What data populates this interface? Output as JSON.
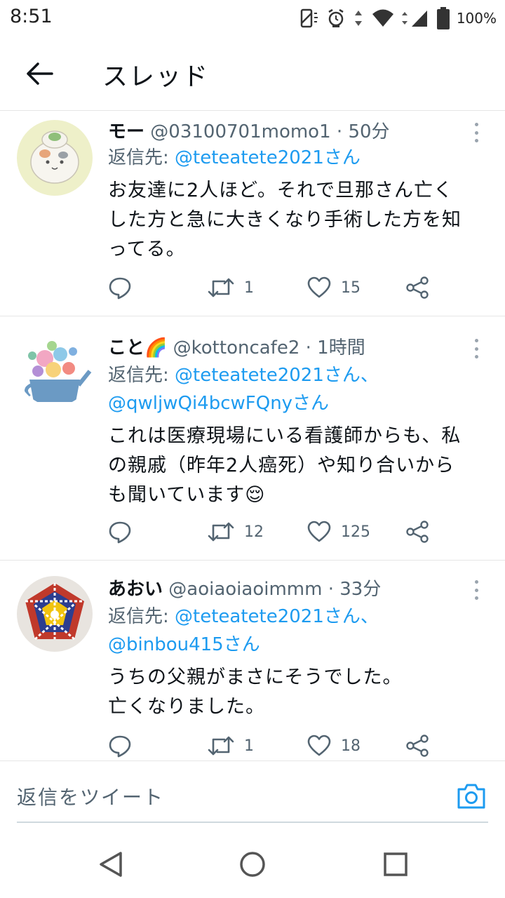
{
  "status_bar": {
    "time": "8:51",
    "battery": "100%",
    "icons": [
      "screen-rotate-icon",
      "alarm-icon",
      "data-arrows-icon",
      "wifi-icon",
      "signal-icon",
      "battery-icon"
    ]
  },
  "header": {
    "title": "スレッド",
    "back_icon": "arrow-left-icon"
  },
  "tweets": [
    {
      "name": "モー",
      "handle": "@03100701momo1",
      "separator": "·",
      "time": "50分",
      "reply_prefix": "返信先: ",
      "reply_to_line1": "@teteatete2021さん",
      "reply_to_line2": "",
      "body_lines": [
        "お友達に2人ほど。それで旦那さん亡く",
        "した方と急に大きくなり手術した方を知",
        "ってる。"
      ],
      "retweets": "1",
      "likes": "15"
    },
    {
      "name": "こと🌈",
      "handle": "@kottoncafe2",
      "separator": "·",
      "time": "1時間",
      "reply_prefix": "返信先: ",
      "reply_to_line1": "@teteatete2021さん、",
      "reply_to_line2": "@qwljwQi4bcwFQnyさん",
      "body_lines": [
        "これは医療現場にいる看護師からも、私",
        "の親戚（昨年2人癌死）や知り合いから",
        "も聞いています😌"
      ],
      "retweets": "12",
      "likes": "125"
    },
    {
      "name": "あおい",
      "handle": "@aoiaoiaoimmm",
      "separator": "·",
      "time": "33分",
      "reply_prefix": "返信先: ",
      "reply_to_line1": "@teteatete2021さん、",
      "reply_to_line2": "@binbou415さん",
      "body_lines": [
        "うちの父親がまさにそうでした。",
        "亡くなりました。"
      ],
      "retweets": "1",
      "likes": "18"
    }
  ],
  "composer": {
    "placeholder": "返信をツイート",
    "camera_icon": "camera-icon"
  },
  "nav": {
    "icons": [
      "back-triangle-icon",
      "home-circle-icon",
      "recents-square-icon"
    ]
  },
  "colors": {
    "link": "#1d9bf0",
    "secondary_text": "#536471",
    "primary_text": "#0f1419",
    "divider": "#e6e6e6"
  }
}
